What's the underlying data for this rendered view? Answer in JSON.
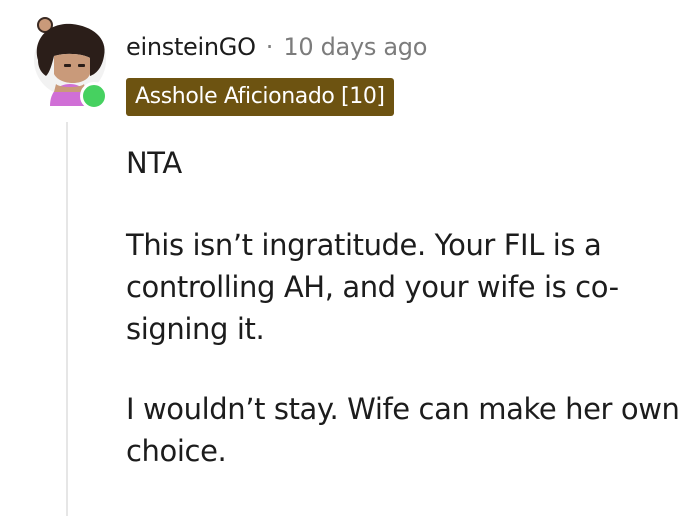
{
  "comment": {
    "author": "einsteinGO",
    "separator": "·",
    "timestamp": "10 days ago",
    "flair": "Asshole Aficionado [10]",
    "online_status": "online",
    "avatar": {
      "icon": "user-avatar-icon",
      "online_indicator_color": "#46d160"
    },
    "paragraphs": [
      "NTA",
      "This isn’t ingratitude. Your FIL is a controlling AH, and your wife is co-signing it.",
      "I wouldn’t stay. Wife can make her own choice."
    ]
  },
  "colors": {
    "flair_background": "#6d5311",
    "flair_text": "#ffffff",
    "meta_text": "#7c7c7c",
    "body_text": "#1c1c1c",
    "thread_line": "#e6e6e6"
  }
}
